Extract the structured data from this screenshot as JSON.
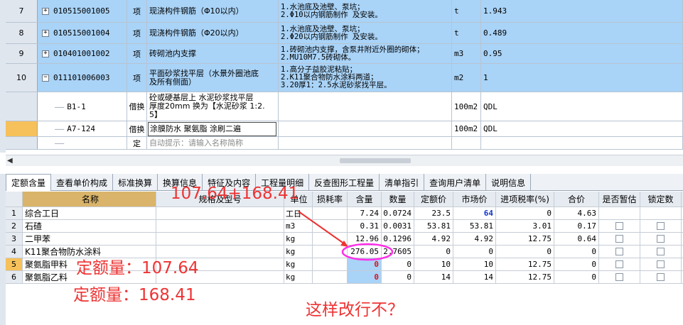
{
  "upper_rows": [
    {
      "no": "7",
      "code": "010515001005",
      "type": "项",
      "name": "现浇构件钢筋（Φ10以内）",
      "feature_lines": [
        "1.水池底及池壁、泵坑；",
        "2.Φ10以内钢筋制作 及安装。"
      ],
      "unit": "t",
      "qty": "1.943"
    },
    {
      "no": "8",
      "code": "010515001004",
      "type": "项",
      "name": "现浇构件钢筋（Φ20以内）",
      "feature_lines": [
        "1.水池底及池壁、泵坑；",
        "2.Φ20以内钢筋制作 及安装。"
      ],
      "unit": "t",
      "qty": "0.489"
    },
    {
      "no": "9",
      "code": "010401001002",
      "type": "项",
      "name": "砖砌池内支撑",
      "feature_lines": [
        "1.砖砌池内支撑，含泵井附近外圈的砌体；",
        "2.MU10M7.5砖砌体。"
      ],
      "unit": "m3",
      "qty": "0.95"
    },
    {
      "no": "10",
      "code": "011101006003",
      "type": "项",
      "name_lines": [
        "平面砂浆找平层（水景外圈池底",
        "及所有侧面）"
      ],
      "feature_lines": [
        "1.高分子益胶泥粘贴；",
        "2.K11聚合物防水涂料两道；",
        "3.20厚1：2.5水泥砂浆找平层。"
      ],
      "unit": "m2",
      "qty": "1"
    }
  ],
  "sub_rows": [
    {
      "code": "B1-1",
      "type": "借换",
      "name_lines": [
        "砼或硬基层上 水泥砂浆找平层",
        "厚度20mm  换为【水泥砂浆 1:2.",
        "5】"
      ],
      "unit": "100m2",
      "qty": "QDL"
    },
    {
      "code": "A7-124",
      "type": "借换",
      "name": "涂膜防水 聚氨脂 涂刷二遍",
      "unit": "100m2",
      "qty": "QDL"
    },
    {
      "code": "",
      "type": "定",
      "placeholder": "自动提示：请输入名称简称",
      "unit": "",
      "qty": ""
    }
  ],
  "tabs": [
    "定额含量",
    "查看单价构成",
    "标准换算",
    "换算信息",
    "特征及内容",
    "工程量明细",
    "反查图形工程量",
    "清单指引",
    "查询用户清单",
    "说明信息"
  ],
  "lower_headers": [
    "名称",
    "规格及型号",
    "单位",
    "损耗率",
    "含量",
    "数量",
    "定额价",
    "市场价",
    "进项税率(%)",
    "合价",
    "是否暂估",
    "锁定数"
  ],
  "lower_rows": [
    {
      "no": "1",
      "name": "综合工日",
      "unit": "工日",
      "content": "7.24",
      "quantity": "0.0724",
      "quota_price": "23.5",
      "market_price": "64",
      "tax_rate": "0",
      "total": "4.63"
    },
    {
      "no": "2",
      "name": "石碴",
      "unit": "m3",
      "content": "0.31",
      "quantity": "0.0031",
      "quota_price": "53.81",
      "market_price": "53.81",
      "tax_rate": "3.01",
      "total": "0.17"
    },
    {
      "no": "3",
      "name": "二甲苯",
      "unit": "kg",
      "content": "12.96",
      "quantity": "0.1296",
      "quota_price": "4.92",
      "market_price": "4.92",
      "tax_rate": "12.75",
      "total": "0.64"
    },
    {
      "no": "4",
      "name": "K11聚合物防水涂料",
      "unit": "kg",
      "content": "276.05",
      "quantity": "2.7605",
      "quota_price": "0",
      "market_price": "0",
      "tax_rate": "0",
      "total": "0"
    },
    {
      "no": "5",
      "name": "聚氨脂甲料",
      "unit": "kg",
      "content": "0",
      "quantity": "0",
      "quota_price": "10",
      "market_price": "10",
      "tax_rate": "12.75",
      "total": "0"
    },
    {
      "no": "6",
      "name": "聚氨脂乙料",
      "unit": "kg",
      "content": "0",
      "quantity": "0",
      "quota_price": "14",
      "market_price": "14",
      "tax_rate": "12.75",
      "total": "0"
    }
  ],
  "annotations": {
    "sum": "107.64+168.41",
    "quota_a": "定额量：107.64",
    "quota_b": "定额量：168.41",
    "question": "这样改行不？"
  },
  "colors": {
    "selected_row": "#a9d3f7",
    "highlight_no": "#f6c15a",
    "annotation": "#ee3333"
  }
}
